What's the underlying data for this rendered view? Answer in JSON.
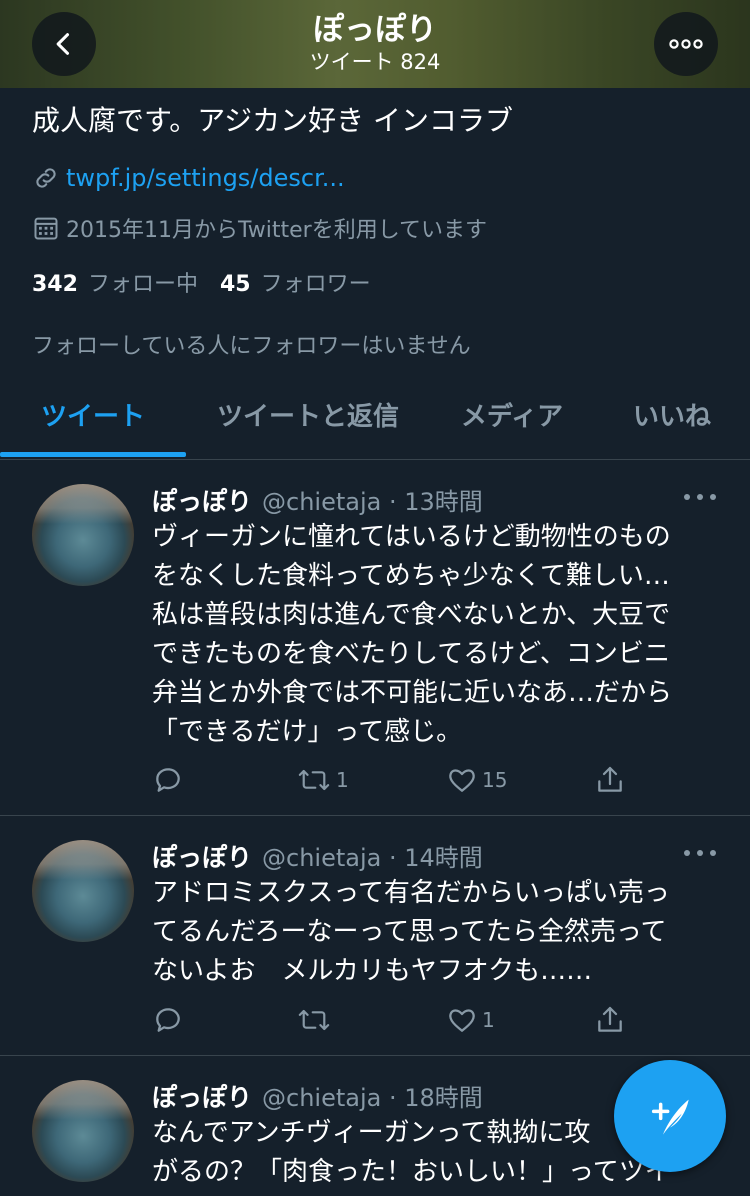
{
  "header": {
    "name": "ぽっぽり",
    "tweet_count_label": "ツイート 824"
  },
  "profile": {
    "bio": "成人腐です。アジカン好き インコラブ",
    "link": "twpf.jp/settings/descr...",
    "joined": "2015年11月からTwitterを利用しています",
    "following_count": "342",
    "following_label": "フォロー中",
    "followers_count": "45",
    "followers_label": "フォロワー",
    "no_mutual_followers": "フォローしている人にフォロワーはいません"
  },
  "tabs": [
    {
      "label": "ツイート",
      "active": true
    },
    {
      "label": "ツイートと返信",
      "active": false
    },
    {
      "label": "メディア",
      "active": false
    },
    {
      "label": "いいね",
      "active": false
    }
  ],
  "tweets": [
    {
      "name": "ぽっぽり",
      "handle_time": "@chietaja · 13時間",
      "lines": [
        "ヴィーガンに憧れてはいるけど動物性のもの",
        "をなくした食料ってめちゃ少なくて難しい…",
        "私は普段は肉は進んで食べないとか、大豆で",
        "できたものを食べたりしてるけど、コンビニ",
        "弁当とか外食では不可能に近いなあ…だから",
        "「できるだけ」って感じ。"
      ],
      "replies": "",
      "retweets": "1",
      "likes": "15"
    },
    {
      "name": "ぽっぽり",
      "handle_time": "@chietaja · 14時間",
      "lines": [
        "アドロミスクスって有名だからいっぱい売っ",
        "てるんだろーなーって思ってたら全然売って",
        "ないよお　メルカリもヤフオクも……"
      ],
      "replies": "",
      "retweets": "",
      "likes": "1"
    },
    {
      "name": "ぽっぽり",
      "handle_time": "@chietaja · 18時間",
      "lines": [
        "なんでアンチヴィーガンって執拗に攻",
        "がるの？「肉食った！おいしい！」ってツイ"
      ],
      "replies": "",
      "retweets": "",
      "likes": ""
    }
  ],
  "colors": {
    "background": "#15202b",
    "accent": "#1da1f2",
    "secondary_text": "#8899a6",
    "divider": "#38444d"
  },
  "icons": {
    "back": "chevron-left-icon",
    "more": "more-horizontal-icon",
    "link": "link-icon",
    "calendar": "calendar-icon",
    "reply": "reply-icon",
    "retweet": "retweet-icon",
    "like": "heart-icon",
    "share": "share-icon",
    "compose": "compose-feather-icon"
  }
}
